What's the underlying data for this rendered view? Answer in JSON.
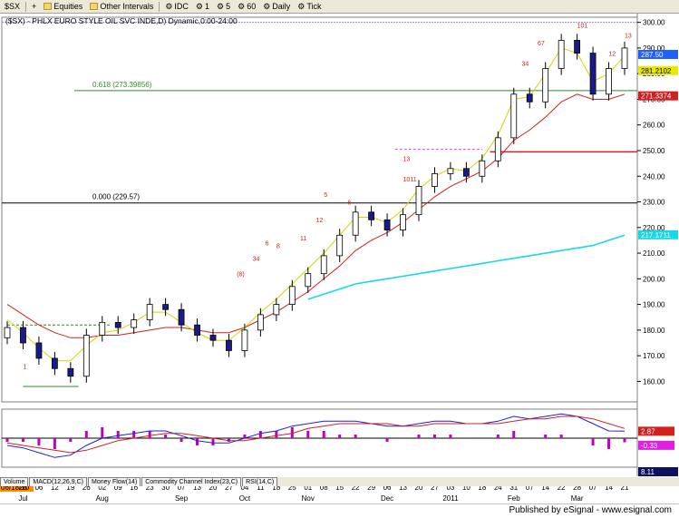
{
  "toolbar": {
    "symbol": "$SX",
    "equities": "Equities",
    "other_intervals": "Other Intervals",
    "idc": "IDC",
    "i1": "1",
    "i5": "5",
    "i60": "60",
    "daily": "Daily",
    "tick": "Tick"
  },
  "footer": {
    "text": "Published by eSignal - www.esignal.com"
  },
  "tabs": [
    "Volume",
    "MACD(12,26,9,C)",
    "Money Flow(14)",
    "Commodity Channel Index(23,C)",
    "RSI(14,C)"
  ],
  "colors": {
    "up": "#ffffff",
    "down": "#1a1a8c",
    "ma_fast": "#d4d400",
    "ma_slow": "#d02020",
    "ma_long": "#18d8e8",
    "fib": "#2e8b2e",
    "macd": "#2020d0",
    "signal": "#d02020",
    "hist": "#c000c0"
  },
  "chart_data": {
    "type": "candlestick",
    "title": "($SX) - PHLX EURO STYLE OIL SVC INDE,D) Dynamic,0:00-24:00",
    "ylim": [
      152,
      302
    ],
    "yticks": [
      160,
      170,
      180,
      190,
      200,
      210,
      220,
      230,
      240,
      250,
      260,
      270,
      280,
      290,
      300
    ],
    "x_date_labels": [
      "06/18/10",
      "28",
      "06",
      "12",
      "19",
      "26",
      "02",
      "09",
      "16",
      "23",
      "30",
      "07",
      "13",
      "20",
      "27",
      "04",
      "11",
      "18",
      "25",
      "01",
      "08",
      "15",
      "22",
      "29",
      "06",
      "13",
      "20",
      "27",
      "03",
      "10",
      "18",
      "24",
      "31",
      "07",
      "14",
      "22",
      "28",
      "07",
      "14",
      "21"
    ],
    "x_month_labels": [
      [
        "Jul",
        1
      ],
      [
        "Aug",
        6
      ],
      [
        "Sep",
        11
      ],
      [
        "Oct",
        15
      ],
      [
        "Nov",
        19
      ],
      [
        "Dec",
        24
      ],
      [
        "2011",
        28
      ],
      [
        "Feb",
        32
      ],
      [
        "Mar",
        36
      ]
    ],
    "fib_levels": [
      {
        "label": "0.618 (273.39856)",
        "value": 273.4
      },
      {
        "label": "0.000 (229.57)",
        "value": 229.57
      }
    ],
    "price_markers": [
      {
        "label": "287.50",
        "value": 287.5,
        "color": "#2060ff"
      },
      {
        "label": "281.2102",
        "value": 281.2,
        "color": "#e8e800"
      },
      {
        "label": "271.3374",
        "value": 271.34,
        "color": "#d02020"
      },
      {
        "label": "217.1711",
        "value": 217.17,
        "color": "#18d8e8"
      }
    ],
    "red_level": 249.5,
    "magenta_level": 250.5,
    "close": [
      181,
      175,
      169,
      165,
      162,
      178,
      183,
      181,
      184,
      190,
      188,
      182,
      178,
      176,
      172,
      180,
      186,
      190,
      197,
      202,
      209,
      217,
      226,
      223,
      219,
      225,
      236,
      241,
      243,
      240,
      246,
      255,
      272,
      269,
      282,
      293,
      288,
      272,
      282,
      290
    ],
    "ma_fast": [
      184,
      179,
      173,
      168,
      168,
      174,
      179,
      180,
      183,
      187,
      187,
      183,
      179,
      176,
      176,
      181,
      187,
      192,
      198,
      204,
      210,
      217,
      224,
      224,
      222,
      227,
      235,
      240,
      243,
      242,
      247,
      256,
      270,
      271,
      280,
      290,
      288,
      277,
      280,
      287
    ],
    "ma_slow": [
      190,
      186,
      182,
      179,
      177,
      177,
      178,
      178,
      179,
      180,
      181,
      181,
      180,
      179,
      179,
      181,
      184,
      187,
      191,
      195,
      200,
      205,
      211,
      215,
      218,
      222,
      227,
      232,
      236,
      239,
      242,
      247,
      254,
      258,
      263,
      269,
      272,
      270,
      270,
      272
    ],
    "ma_long": [
      null,
      null,
      null,
      null,
      null,
      null,
      null,
      null,
      null,
      null,
      null,
      null,
      null,
      null,
      null,
      null,
      null,
      null,
      null,
      192,
      194,
      196,
      198,
      199,
      200,
      201,
      202,
      203,
      204,
      205,
      206,
      207,
      208,
      209,
      210,
      211,
      212,
      213,
      215,
      217
    ],
    "macd": [
      -3,
      -4,
      -6,
      -8,
      -7,
      -3,
      0,
      1,
      2,
      3,
      3,
      1,
      -1,
      -2,
      -2,
      0,
      2,
      3,
      5,
      6,
      7,
      7,
      7,
      6,
      5,
      5,
      6,
      7,
      7,
      6,
      6,
      7,
      9,
      8,
      9,
      10,
      9,
      6,
      3,
      2.87
    ],
    "macd_signal": [
      -2,
      -3,
      -4,
      -5,
      -6,
      -5,
      -3,
      -1,
      0,
      1,
      2,
      2,
      1,
      0,
      -1,
      -1,
      0,
      1,
      2,
      4,
      5,
      6,
      6,
      6,
      6,
      5,
      5,
      6,
      6,
      6,
      6,
      6,
      7,
      8,
      8,
      9,
      9,
      8,
      6,
      4
    ],
    "macd_hist_last": -0.33,
    "macd_labels": [
      "2.87",
      "-0.33"
    ],
    "volume_label": "8.11",
    "seq_annotations": [
      {
        "t": "101",
        "x": 36,
        "y": 298
      },
      {
        "t": "13",
        "x": 39,
        "y": 294
      },
      {
        "t": "12",
        "x": 38,
        "y": 287
      },
      {
        "t": "67",
        "x": 33.5,
        "y": 291
      },
      {
        "t": "34",
        "x": 32.5,
        "y": 283
      },
      {
        "t": "13",
        "x": 25,
        "y": 246
      },
      {
        "t": "1011",
        "x": 25,
        "y": 238
      },
      {
        "t": "5",
        "x": 20,
        "y": 232
      },
      {
        "t": "6",
        "x": 21.5,
        "y": 229
      },
      {
        "t": "12",
        "x": 19.5,
        "y": 222
      },
      {
        "t": "11",
        "x": 18.5,
        "y": 215
      },
      {
        "t": "8",
        "x": 17,
        "y": 212
      },
      {
        "t": "6",
        "x": 16.3,
        "y": 213
      },
      {
        "t": "34",
        "x": 15.5,
        "y": 207
      },
      {
        "t": "(8)",
        "x": 14.5,
        "y": 201
      },
      {
        "t": "1",
        "x": 1,
        "y": 165
      }
    ]
  }
}
